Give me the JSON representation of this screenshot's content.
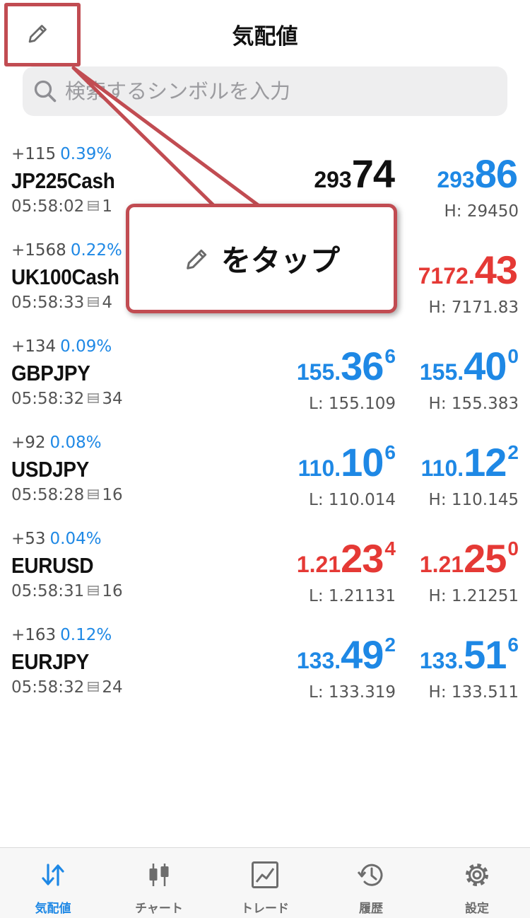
{
  "header": {
    "title": "気配値",
    "edit_icon": "pencil-icon"
  },
  "search": {
    "placeholder": "検索するシンボルを入力",
    "icon": "search-icon"
  },
  "callout": {
    "text": "をタップ",
    "icon": "pencil-icon"
  },
  "quotes": [
    {
      "change": "+115",
      "percent": "0.39%",
      "symbol": "JP225Cash",
      "time": "05:58:02",
      "spread": "1",
      "bid": {
        "small": "293",
        "big": "74",
        "sup": "",
        "color": "black"
      },
      "low": "",
      "ask": {
        "small": "293",
        "big": "86",
        "sup": "",
        "color": "blue"
      },
      "high": "H: 29450"
    },
    {
      "change": "+1568",
      "percent": "0.22%",
      "symbol": "UK100Cash",
      "time": "05:58:33",
      "spread": "4",
      "bid": {
        "small": "",
        "big": "",
        "sup": "",
        "color": "red"
      },
      "low": "",
      "ask": {
        "small": "7172.",
        "big": "43",
        "sup": "",
        "color": "red"
      },
      "high": "H: 7171.83"
    },
    {
      "change": "+134",
      "percent": "0.09%",
      "symbol": "GBPJPY",
      "time": "05:58:32",
      "spread": "34",
      "bid": {
        "small": "155.",
        "big": "36",
        "sup": "6",
        "color": "blue"
      },
      "low": "L: 155.109",
      "ask": {
        "small": "155.",
        "big": "40",
        "sup": "0",
        "color": "blue"
      },
      "high": "H: 155.383"
    },
    {
      "change": "+92",
      "percent": "0.08%",
      "symbol": "USDJPY",
      "time": "05:58:28",
      "spread": "16",
      "bid": {
        "small": "110.",
        "big": "10",
        "sup": "6",
        "color": "blue"
      },
      "low": "L: 110.014",
      "ask": {
        "small": "110.",
        "big": "12",
        "sup": "2",
        "color": "blue"
      },
      "high": "H: 110.145"
    },
    {
      "change": "+53",
      "percent": "0.04%",
      "symbol": "EURUSD",
      "time": "05:58:31",
      "spread": "16",
      "bid": {
        "small": "1.21",
        "big": "23",
        "sup": "4",
        "color": "red"
      },
      "low": "L: 1.21131",
      "ask": {
        "small": "1.21",
        "big": "25",
        "sup": "0",
        "color": "red"
      },
      "high": "H: 1.21251"
    },
    {
      "change": "+163",
      "percent": "0.12%",
      "symbol": "EURJPY",
      "time": "05:58:32",
      "spread": "24",
      "bid": {
        "small": "133.",
        "big": "49",
        "sup": "2",
        "color": "blue"
      },
      "low": "L: 133.319",
      "ask": {
        "small": "133.",
        "big": "51",
        "sup": "6",
        "color": "blue"
      },
      "high": "H: 133.511"
    }
  ],
  "tabs": [
    {
      "label": "気配値",
      "icon": "quotes-arrows-icon",
      "active": true
    },
    {
      "label": "チャート",
      "icon": "candlestick-icon",
      "active": false
    },
    {
      "label": "トレード",
      "icon": "trade-chart-icon",
      "active": false
    },
    {
      "label": "履歴",
      "icon": "history-icon",
      "active": false
    },
    {
      "label": "設定",
      "icon": "gear-icon",
      "active": false
    }
  ],
  "colors": {
    "blue": "#1e88e5",
    "red": "#e53935",
    "annotation": "#c14c52"
  }
}
